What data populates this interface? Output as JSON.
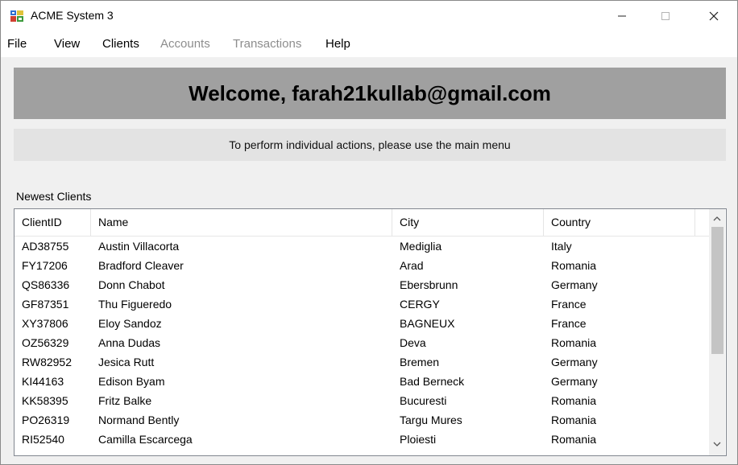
{
  "window": {
    "title": "ACME System 3"
  },
  "menu": [
    {
      "label": "File",
      "enabled": true
    },
    {
      "label": "View",
      "enabled": true
    },
    {
      "label": "Clients",
      "enabled": true
    },
    {
      "label": "Accounts",
      "enabled": false
    },
    {
      "label": "Transactions",
      "enabled": false
    },
    {
      "label": "Help",
      "enabled": true
    }
  ],
  "welcome": "Welcome, farah21kullab@gmail.com",
  "hint": "To perform individual actions, please use the main menu",
  "section_label": "Newest Clients",
  "table": {
    "columns": [
      "ClientID",
      "Name",
      "City",
      "Country"
    ],
    "rows": [
      [
        "AD38755",
        "Austin Villacorta",
        "Mediglia",
        "Italy"
      ],
      [
        "FY17206",
        "Bradford Cleaver",
        "Arad",
        "Romania"
      ],
      [
        "QS86336",
        "Donn Chabot",
        "Ebersbrunn",
        "Germany"
      ],
      [
        "GF87351",
        "Thu Figueredo",
        "CERGY",
        "France"
      ],
      [
        "XY37806",
        "Eloy Sandoz",
        "BAGNEUX",
        "France"
      ],
      [
        "OZ56329",
        "Anna Dudas",
        "Deva",
        "Romania"
      ],
      [
        "RW82952",
        "Jesica Rutt",
        "Bremen",
        "Germany"
      ],
      [
        "KI44163",
        "Edison Byam",
        "Bad Berneck",
        "Germany"
      ],
      [
        "KK58395",
        "Fritz Balke",
        "Bucuresti",
        "Romania"
      ],
      [
        "PO26319",
        "Normand Bently",
        "Targu Mures",
        "Romania"
      ],
      [
        "RI52540",
        "Camilla Escarcega",
        "Ploiesti",
        "Romania"
      ]
    ]
  },
  "icons": {
    "app": "app-icon",
    "minimize": "minimize-icon",
    "maximize": "maximize-icon",
    "close": "close-icon",
    "scroll_up": "chevron-up-icon",
    "scroll_down": "chevron-down-icon"
  },
  "colors": {
    "welcome_bg": "#a0a0a0",
    "hint_bg": "#e3e3e3",
    "disabled_menu": "#8d8d8d"
  }
}
